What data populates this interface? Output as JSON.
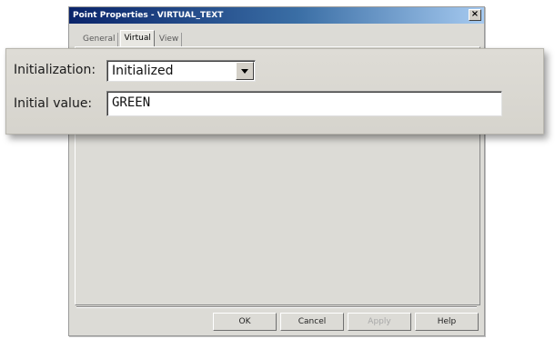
{
  "dialog": {
    "title": "Point Properties - VIRTUAL_TEXT",
    "close_glyph": "×",
    "tabs": [
      {
        "label": "General"
      },
      {
        "label": "Virtual"
      },
      {
        "label": "View"
      }
    ],
    "active_tab": "Virtual",
    "buttons": {
      "ok": "OK",
      "cancel": "Cancel",
      "apply": "Apply",
      "help": "Help"
    }
  },
  "callout": {
    "initialization": {
      "label": "Initialization:",
      "selected_value": "Initialized"
    },
    "initial_value": {
      "label": "Initial value:",
      "value": "GREEN"
    }
  },
  "colors": {
    "titlebar_start": "#0a246a",
    "titlebar_end": "#a6caf0",
    "dialog_face": "#dcdbd6"
  }
}
